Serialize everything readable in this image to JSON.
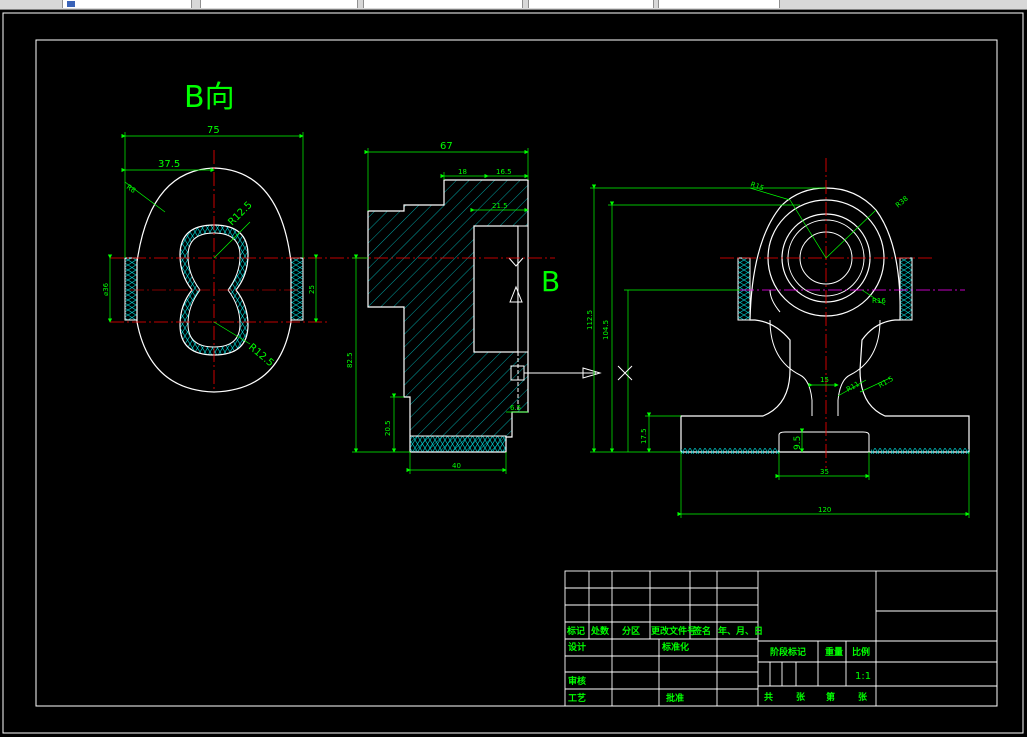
{
  "tabs": [
    {
      "label": ""
    },
    {
      "label": ""
    },
    {
      "label": ""
    },
    {
      "label": ""
    },
    {
      "label": ""
    }
  ],
  "views": {
    "b_view_label": "B向",
    "section_label": "B"
  },
  "dimensions": {
    "left": {
      "width_75": "75",
      "half_37_5": "37.5",
      "r12_5_top": "R12.5",
      "r12_5_bottom": "R12.5",
      "d36": "⌀36",
      "h25": "25",
      "r_small": "R8"
    },
    "middle": {
      "w67": "67",
      "w18": "18",
      "w16_5": "16.5",
      "w21_5": "21.5",
      "h82_5": "82.5",
      "h20_5": "20.5",
      "w40": "40",
      "w6_5": "6.5"
    },
    "right": {
      "h112_5": "112.5",
      "h104_5": "104.5",
      "h17_5": "17.5",
      "w120": "120",
      "w35": "35",
      "h9_5": "9.5",
      "w15": "15",
      "r_top": "R15",
      "r_big": "R38",
      "r_mid": "R16",
      "r11": "R11",
      "r1_5": "R1.5"
    }
  },
  "title_block": {
    "mark": "标记",
    "count": "处数",
    "zone": "分区",
    "doc_no": "更改文件号",
    "sign": "签名",
    "date": "年、月、日",
    "design": "设计",
    "standard": "标准化",
    "stage_mark": "阶段标记",
    "weight": "重量",
    "scale": "比例",
    "scale_value": "1:1",
    "review": "审核",
    "process": "工艺",
    "approve": "批准",
    "total": "共",
    "sheets": "张",
    "page": "第",
    "page_suffix": "张"
  },
  "colors": {
    "background": "#000000",
    "frame": "#ffffff",
    "dimension": "#00ff00",
    "centerline": "#ff0000",
    "hatch": "#00ffff",
    "knurl": "#00ffff",
    "phantom": "#ff00ff"
  }
}
